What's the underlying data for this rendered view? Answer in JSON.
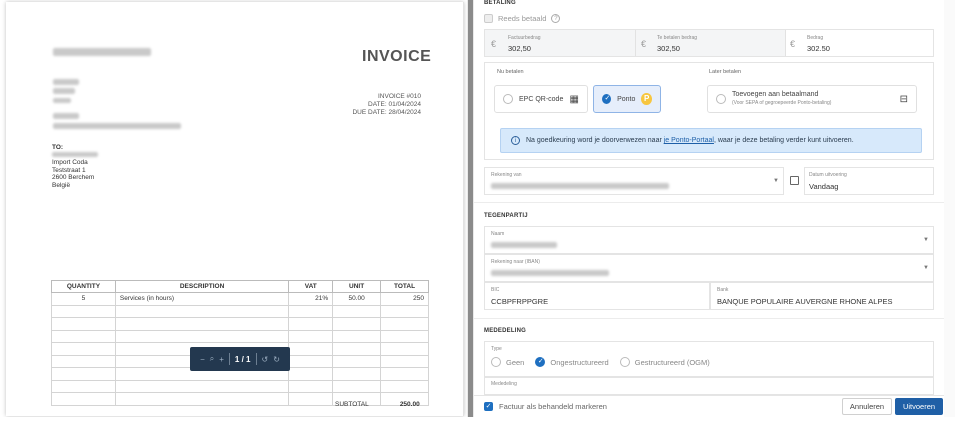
{
  "invoice": {
    "title": "INVOICE",
    "number": "INVOICE #010",
    "date": "DATE: 01/04/2024",
    "due_date": "DUE DATE: 28/04/2024",
    "to_label": "TO:",
    "to_lines": [
      "Import Coda",
      "Teststraat 1",
      "2600 Berchem",
      "België"
    ],
    "table": {
      "headers": [
        "QUANTITY",
        "DESCRIPTION",
        "VAT",
        "UNIT",
        "TOTAL"
      ],
      "rows": [
        [
          "5",
          "Services (in hours)",
          "21%",
          "50.00",
          "250"
        ]
      ]
    },
    "subtotal_label": "SUBTOTAL",
    "subtotal_value": "250.00"
  },
  "pdf_toolbar": {
    "zoom_out_icon": "−",
    "zoom_icon": "⌕",
    "zoom_in_icon": "+",
    "page_indicator": "1 / 1",
    "rotate_left_icon": "↺",
    "rotate_right_icon": "↻"
  },
  "payment": {
    "section_title": "BETALING",
    "already_paid_label": "Reeds betaald",
    "help_icon": "?",
    "currency_symbol": "€",
    "invoice_amount_label": "Factuurbedrag",
    "invoice_amount": "302,50",
    "to_pay_label": "Te betalen bedrag",
    "to_pay": "302,50",
    "amount_label": "Bedrag",
    "amount": "302.50",
    "pay_now_label": "Nu betalen",
    "pay_later_label": "Later betalen",
    "option_epc": "EPC QR-code",
    "option_ponto": "Ponto",
    "option_later_title": "Toevoegen aan betaalmand",
    "option_later_sub": "(Voor SEPA of gegroepeerde Ponto-betaling)",
    "info_text_before": "Na goedkeuring word je doorverwezen naar ",
    "info_link": "je Ponto-Portaal",
    "info_text_after": ", waar je deze betaling verder kunt uitvoeren.",
    "account_from_label": "Rekening van",
    "execution_date_label": "Datum uitvoering",
    "execution_date": "Vandaag"
  },
  "counterparty": {
    "section_title": "TEGENPARTIJ",
    "name_label": "Naam",
    "account_to_label": "Rekening naar (IBAN)",
    "bic_label": "BIC",
    "bic": "CCBPFRPPGRE",
    "bank_label": "Bank",
    "bank": "BANQUE POPULAIRE AUVERGNE RHONE ALPES"
  },
  "communication": {
    "section_title": "MEDEDELING",
    "type_label": "Type",
    "type_none": "Geen",
    "type_unstructured": "Ongestructureerd",
    "type_structured": "Gestructureerd (OGM)",
    "message_label": "Mededeling"
  },
  "footer": {
    "mark_processed_label": "Factuur als behandeld markeren",
    "cancel_label": "Annuleren",
    "execute_label": "Uitvoeren"
  },
  "colors": {
    "primary": "#1f5fa6",
    "info_bg": "#d7e9fb",
    "toolbar_bg": "#23384f"
  }
}
